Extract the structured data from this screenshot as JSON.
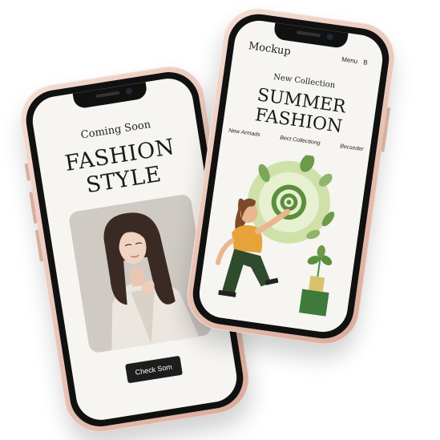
{
  "left_phone": {
    "coming_soon": "Coming Soon",
    "title_line1": "FASHION",
    "title_line2": "STYLE",
    "cta_label": "Check Som"
  },
  "right_phone": {
    "logo": "Mockup",
    "menu": "Menu",
    "menu_icon_char": "B",
    "new_collection": "New Collection",
    "title_line1": "SUMMER",
    "title_line2": "FASHION",
    "nav": [
      "New Armads",
      "Bect Collectiong",
      "Becseder"
    ]
  },
  "colors": {
    "phone_frame": "#e9c4b6",
    "screen_bg": "#f6f5f1",
    "button_bg": "#1d1d1d",
    "leaf_green": "#5a8f3c",
    "shirt": "#e8a23a",
    "pants": "#2f4a2c"
  }
}
